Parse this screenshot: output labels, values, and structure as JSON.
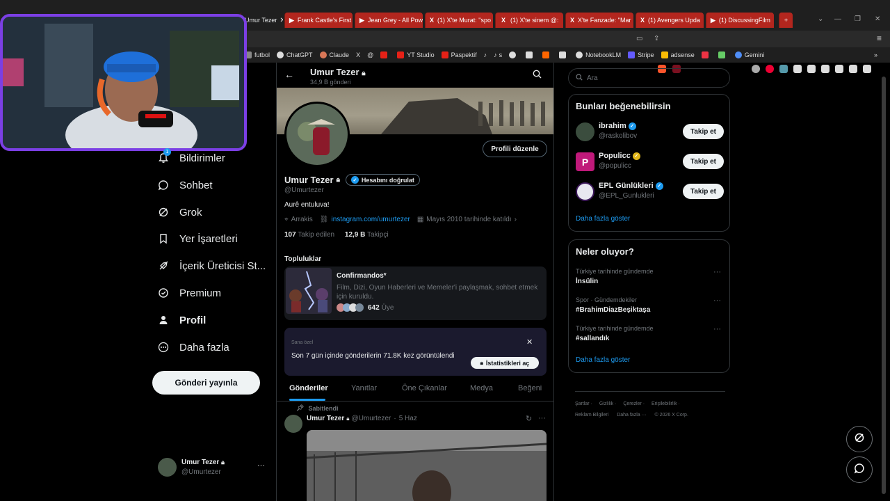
{
  "browser": {
    "tabs": [
      {
        "label": "Umur Tezer",
        "active": true
      },
      {
        "label": "Frank Castle's First"
      },
      {
        "label": "Jean Grey - All Pow"
      },
      {
        "label": "(1) X'te Murat: \"spo"
      },
      {
        "label": "(1) X'te sinem @:"
      },
      {
        "label": "X'te Fanzade: \"Mar"
      },
      {
        "label": "(1) Avengers Upda"
      },
      {
        "label": "(1) DiscussingFilm"
      }
    ],
    "new_tab": "+",
    "window_controls": {
      "minimize": "—",
      "restore": "❐",
      "close": "✕"
    },
    "bookmarks": [
      "futbol",
      "ChatGPT",
      "Claude",
      "",
      "",
      "",
      "YT Studio",
      "Paspektif",
      "",
      "s",
      "",
      "",
      "",
      "NotebookLM",
      "Stripe",
      "adsense",
      "",
      "",
      "Gemini"
    ]
  },
  "nav": {
    "items": [
      {
        "label": "Bildirimler",
        "icon": "bell-icon",
        "badge": "1"
      },
      {
        "label": "Sohbet",
        "icon": "chat-icon"
      },
      {
        "label": "Grok",
        "icon": "grok-icon"
      },
      {
        "label": "Yer İşaretleri",
        "icon": "bookmark-icon"
      },
      {
        "label": "İçerik Üreticisi St...",
        "icon": "rocket-icon"
      },
      {
        "label": "Premium",
        "icon": "premium-icon"
      },
      {
        "label": "Profil",
        "icon": "person-icon"
      },
      {
        "label": "Daha fazla",
        "icon": "more-circle-icon"
      }
    ],
    "post_button": "Gönderi yayınla",
    "account": {
      "name": "Umur Tezer",
      "handle": "@Umurtezer",
      "more": "···"
    }
  },
  "profile": {
    "header_name": "Umur Tezer",
    "header_posts": "34,9 B gönderi",
    "name": "Umur Tezer",
    "verify_label": "Hesabını doğrulat",
    "handle": "@Umurtezer",
    "edit_button": "Profili düzenle",
    "bio": "Aurê entuluva!",
    "location": "Arrakis",
    "website": "instagram.com/umurtezer",
    "joined": "Mayıs 2010 tarihinde katıldı",
    "following_count": "107",
    "following_label": "Takip edilen",
    "followers_count": "12,9 B",
    "followers_label": "Takipçi",
    "communities_title": "Topluluklar",
    "community": {
      "name": "Confirmandos*",
      "desc": "Film, Dizi, Oyun Haberleri ve Memeler'i paylaşmak, sohbet etmek için kuruldu.",
      "members_count": "642",
      "members_label": "Üye"
    },
    "stats_banner": {
      "label": "Sana özel",
      "text": "Son 7 gün içinde gönderilerin 71.8K kez görüntülendi",
      "button": "İstatistikleri aç",
      "close": "✕"
    },
    "tabs": [
      "Gönderiler",
      "Yanıtlar",
      "Öne Çıkanlar",
      "Medya",
      "Beğeni"
    ],
    "pinned_label": "Sabitlendi",
    "post": {
      "name": "Umur Tezer",
      "handle": "@Umurtezer",
      "sep": "·",
      "date": "5 Haz",
      "more": "···"
    }
  },
  "right": {
    "search_placeholder": "Ara",
    "suggestions_title": "Bunları beğenebilirsin",
    "suggestions": [
      {
        "name": "ibrahim",
        "handle": "@raskolibov",
        "follow": "Takip et",
        "badge": "blue"
      },
      {
        "name": "Populicc",
        "handle": "@populicc",
        "follow": "Takip et",
        "badge": "gold"
      },
      {
        "name": "EPL Günlükleri",
        "handle": "@EPL_Gunlukleri",
        "follow": "Takip et",
        "badge": "blue"
      }
    ],
    "show_more": "Daha fazla göster",
    "trends_title": "Neler oluyor?",
    "trends": [
      {
        "context": "Türkiye tarihinde gündemde",
        "topic": "İnsülin"
      },
      {
        "context": "Spor · Gündemdekiler",
        "topic": "#BrahimDiazBeşiktaşa"
      },
      {
        "context": "Türkiye tarihinde gündemde",
        "topic": "#sallandık"
      }
    ],
    "trends_more": "Daha fazla göster",
    "footer_line1": [
      "Şartlar",
      "Gizlilik",
      "Çerezler",
      "Erişilebilirlik"
    ],
    "footer_line2": [
      "Reklam Bilgileri",
      "Daha fazla ···",
      "© 2026 X Corp."
    ]
  },
  "colors": {
    "accent": "#1d9bf0",
    "webcam_border": "#7b3fe4",
    "tab_red": "#b3261e"
  }
}
